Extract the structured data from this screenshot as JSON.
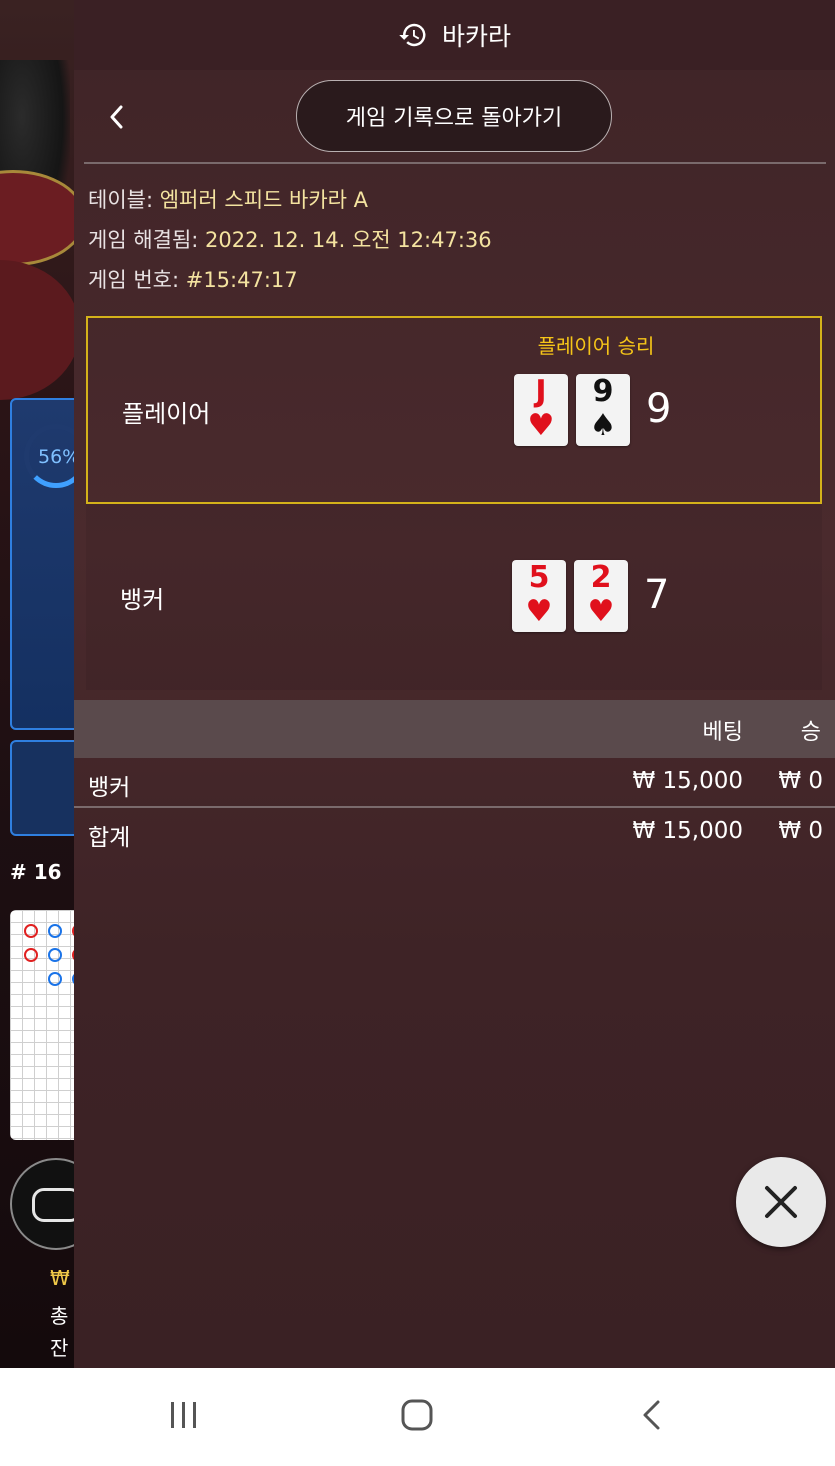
{
  "background": {
    "stat_percent": "56%",
    "round_label": "# 16",
    "balance": "₩",
    "total_bet_label": "총",
    "remaining_label": "잔"
  },
  "panel": {
    "title": "바카라",
    "back_to_history_label": "게임 기록으로 돌아가기",
    "info": {
      "table_label": "테이블:",
      "table_value": "엠퍼러 스피드 바카라 A",
      "resolved_label": "게임 해결됨:",
      "resolved_value": "2022. 12. 14. 오전 12:47:36",
      "number_label": "게임 번호:",
      "number_value": "#15:47:17"
    },
    "winner_label": "플레이어 승리",
    "player": {
      "label": "플레이어",
      "cards": [
        {
          "rank": "J",
          "suit": "♥",
          "color": "red"
        },
        {
          "rank": "9",
          "suit": "♠",
          "color": "black"
        }
      ],
      "score": "9"
    },
    "banker": {
      "label": "뱅커",
      "cards": [
        {
          "rank": "5",
          "suit": "♥",
          "color": "red"
        },
        {
          "rank": "2",
          "suit": "♥",
          "color": "red"
        }
      ],
      "score": "7"
    },
    "bets": {
      "header_bet": "베팅",
      "header_win": "승",
      "rows": [
        {
          "name": "뱅커",
          "amount": "₩ 15,000",
          "win": "₩ 0"
        },
        {
          "name": "합계",
          "amount": "₩ 15,000",
          "win": "₩ 0"
        }
      ]
    }
  },
  "colors": {
    "winner_gold": "#f5c518",
    "card_red": "#e0101c",
    "panel_bg": "#4a2a2d"
  },
  "icons": [
    "history-icon",
    "chevron-left-icon",
    "close-icon",
    "nav-recents-icon",
    "nav-home-icon",
    "nav-back-icon"
  ]
}
